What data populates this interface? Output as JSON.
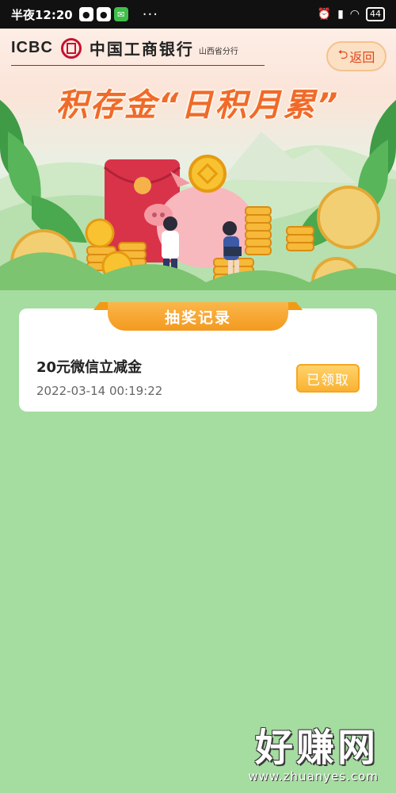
{
  "status_bar": {
    "time": "半夜12:20",
    "more": "···",
    "battery": "44"
  },
  "banner": {
    "bank_abbr": "ICBC",
    "bank_name": "中国工商银行",
    "branch": "山西省分行",
    "back_label": "返回",
    "headline": "积存金“日积月累”"
  },
  "record": {
    "section_title": "抽奖记录",
    "items": [
      {
        "title": "20元微信立减金",
        "time": "2022-03-14 00:19:22",
        "status_label": "已领取"
      }
    ]
  },
  "watermark": {
    "main": "好赚网",
    "url": "www.zhuanyes.com"
  },
  "colors": {
    "background": "#a5dca0",
    "accent_orange": "#f39a1f",
    "headline": "#f06a2a",
    "brand_red": "#c8102e"
  }
}
